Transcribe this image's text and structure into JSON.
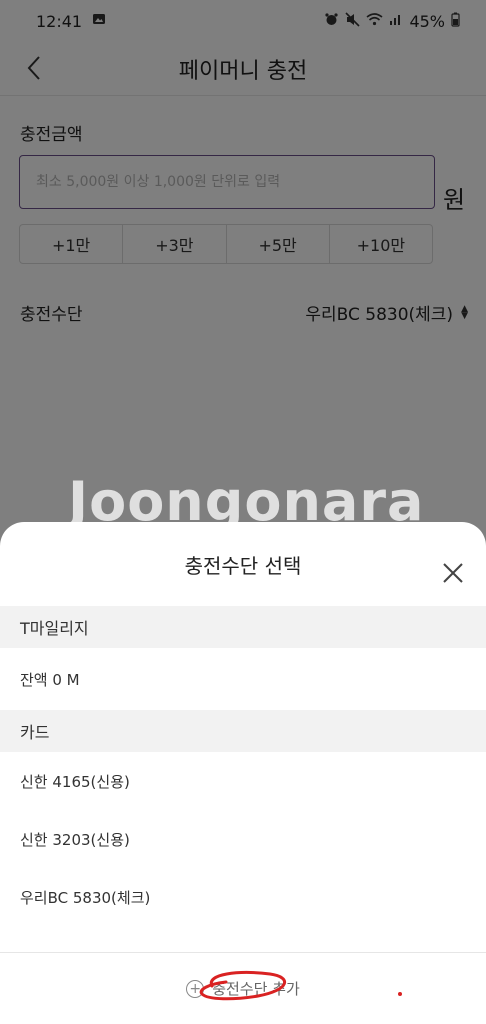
{
  "status_bar": {
    "time": "12:41",
    "battery": "45%",
    "icons": [
      "gallery-icon",
      "alarm-icon",
      "mute-icon",
      "wifi-icon",
      "signal-icon",
      "battery-icon"
    ]
  },
  "header": {
    "title": "페이머니 충전",
    "back_icon": "chevron-left-icon"
  },
  "charge_amount": {
    "label": "충전금액",
    "placeholder": "최소 5,000원 이상 1,000원 단위로 입력",
    "value": "",
    "unit": "원",
    "quick_buttons": [
      "+1만",
      "+3만",
      "+5만",
      "+10만"
    ]
  },
  "charge_method": {
    "label": "충전수단",
    "selected": "우리BC 5830(체크)"
  },
  "watermark": "Joongonara",
  "sheet": {
    "title": "충전수단 선택",
    "groups": [
      {
        "label": "T마일리지",
        "items": [
          "잔액 0 M"
        ]
      },
      {
        "label": "카드",
        "items": [
          "신한 4165(신용)",
          "신한 3203(신용)",
          "우리BC 5830(체크)"
        ]
      }
    ],
    "footer_label": "충전수단 추가"
  },
  "colors": {
    "input_border": "#6b4f8a",
    "annotation": "#d92222",
    "overlay": "rgba(0,0,0,0.5)"
  }
}
